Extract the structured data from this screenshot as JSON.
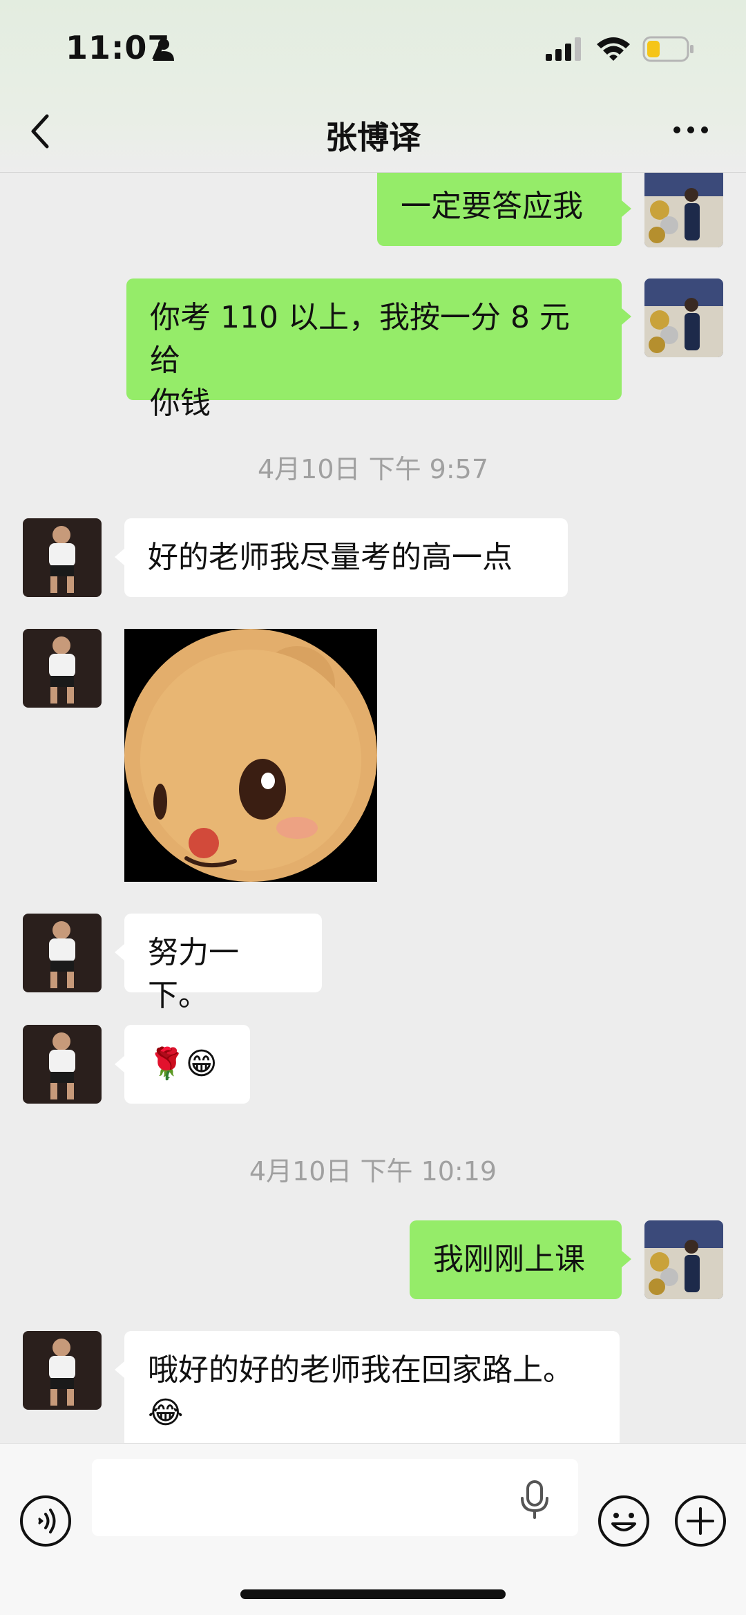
{
  "status_bar": {
    "time": "11:07"
  },
  "header": {
    "title": "张博译"
  },
  "messages": [
    {
      "text": "一定要答应我"
    },
    {
      "text": "你考 110 以上，我按一分 8 元给\n你钱"
    },
    {
      "text": "4月10日 下午 9:57"
    },
    {
      "text": "好的老师我尽量考的高一点"
    },
    {
      "text": "[sticker: bear face]"
    },
    {
      "text": "努力一下。"
    },
    {
      "text": "🌹😁"
    },
    {
      "text": "4月10日 下午 10:19"
    },
    {
      "text": "我刚刚上课"
    },
    {
      "text": "哦好的好的老师我在回家路上。\n😂"
    }
  ],
  "composer": {
    "placeholder": ""
  }
}
